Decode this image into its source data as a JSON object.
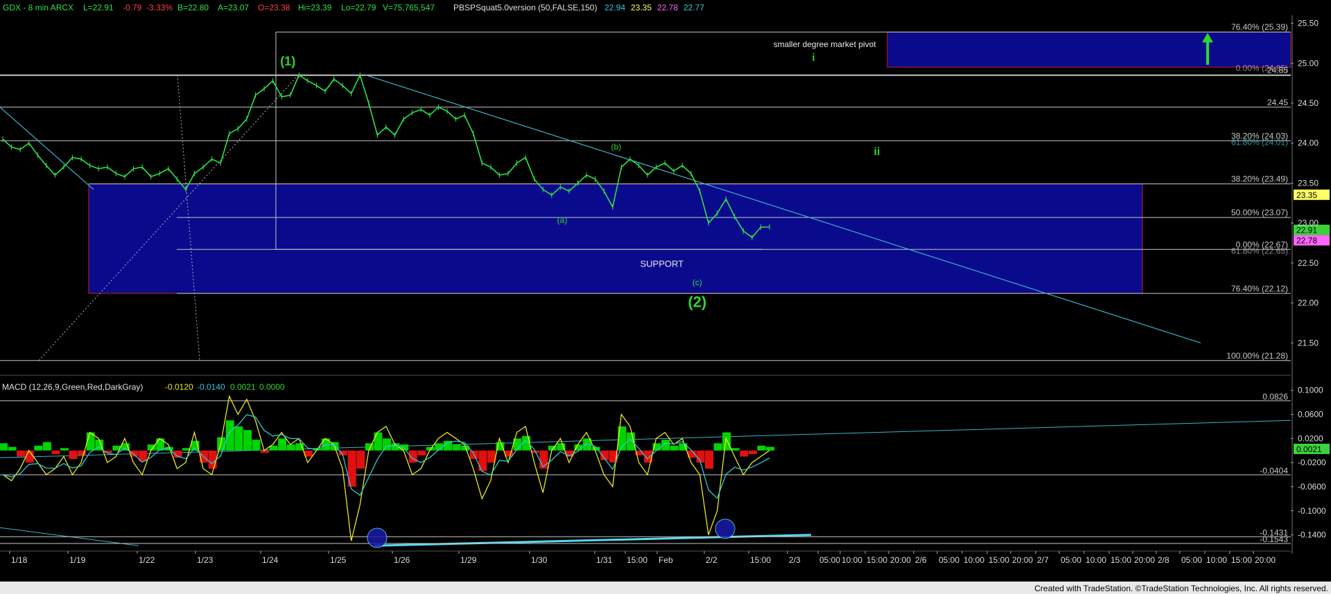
{
  "header": {
    "symbol": "GDX - 8 min ARCX",
    "last": "L=22.91",
    "change": "-0.79",
    "change_pct": "-3.33%",
    "bid": "B=22.80",
    "ask": "A=23.07",
    "open": "O=23.38",
    "high": "Hi=23.39",
    "low": "Lo=22.79",
    "volume": "V=75,765,547",
    "study": "PBSPSquat5.0version (50,FALSE,150)",
    "study_values": [
      "22.94",
      "23.35",
      "22.78",
      "22.77"
    ]
  },
  "colors": {
    "background": "#000000",
    "price": "#2ee24a",
    "accent_green": "#2bd82b",
    "fib_text": "#c8c8c8",
    "fib_line": "#c8c8c8",
    "trendline": "#3cb4c8",
    "box_fill": "#0a0a8c",
    "box_border": "#c0202a",
    "macd_pos": "#00d400",
    "macd_neg": "#e01010",
    "macd_line": "#eaea20",
    "signal_line": "#30c8d8",
    "footer_bg": "#e8e8e8",
    "last_price_tag": "#3cd23c",
    "tag_yellow": "#ffff66",
    "tag_magenta": "#ff66ff"
  },
  "chart_data": [
    {
      "type": "line",
      "name": "price",
      "ylim": [
        21.2,
        25.6
      ],
      "grid": false,
      "yticks": [
        "25.50",
        "25.00",
        "24.50",
        "24.00",
        "23.50",
        "23.00",
        "22.50",
        "22.00",
        "21.50"
      ],
      "ytick_values": [
        25.5,
        25.0,
        24.5,
        24.0,
        23.5,
        23.0,
        22.5,
        22.0,
        21.5
      ],
      "x_session_labels": [
        "1/18",
        "1/19",
        "1/22",
        "1/23",
        "1/24",
        "1/25",
        "1/26",
        "1/29",
        "1/30",
        "1/31",
        "15:00",
        "Feb",
        "2/2",
        "15:00",
        "2/3",
        "05:00",
        "10:00",
        "15:00",
        "20:00",
        "2/6",
        "05:00",
        "10:00",
        "15:00",
        "20:00",
        "2/7",
        "05:00",
        "10:00",
        "15:00",
        "20:00",
        "2/8",
        "05:00",
        "10:00",
        "15:00",
        "20:00"
      ],
      "price_path": [
        24.05,
        23.95,
        23.92,
        24.0,
        23.85,
        23.72,
        23.6,
        23.7,
        23.82,
        23.8,
        23.72,
        23.68,
        23.7,
        23.62,
        23.58,
        23.68,
        23.7,
        23.58,
        23.62,
        23.68,
        23.55,
        23.42,
        23.62,
        23.7,
        23.8,
        23.75,
        24.12,
        24.18,
        24.3,
        24.6,
        24.68,
        24.78,
        24.58,
        24.6,
        24.85,
        24.78,
        24.72,
        24.65,
        24.8,
        24.72,
        24.62,
        24.85,
        24.5,
        24.1,
        24.2,
        24.1,
        24.3,
        24.38,
        24.42,
        24.35,
        24.45,
        24.4,
        24.3,
        24.35,
        24.12,
        23.75,
        23.7,
        23.6,
        23.62,
        23.75,
        23.82,
        23.55,
        23.42,
        23.35,
        23.45,
        23.4,
        23.5,
        23.6,
        23.55,
        23.4,
        23.2,
        23.7,
        23.8,
        23.72,
        23.6,
        23.7,
        23.75,
        23.65,
        23.72,
        23.62,
        23.4,
        23.0,
        23.12,
        23.3,
        23.08,
        22.9,
        22.82,
        22.95,
        22.95
      ],
      "fib_levels": [
        {
          "label": "76.40% (25.39)",
          "value": 25.39
        },
        {
          "label": "24.85",
          "value": 24.85
        },
        {
          "label": "24.45",
          "value": 24.45
        },
        {
          "label": "38.20% (24.03)",
          "value": 24.03
        },
        {
          "label": "38.20% (23.49)",
          "value": 23.49
        },
        {
          "label": "50.00% (23.07)",
          "value": 23.07
        },
        {
          "label": "0.00% (22.67)",
          "value": 22.67
        },
        {
          "label": "76.40% (22.12)",
          "value": 22.12
        },
        {
          "label": "100.00% (21.28)",
          "value": 21.28
        }
      ],
      "fib_overlap_labels": [
        "0.00% (24.85)",
        "61.80% (24.01)",
        "61.80% (22.65)"
      ],
      "annotations": [
        {
          "text": "(1)",
          "x_session": 4.4,
          "y": 24.97
        },
        {
          "text": "(b)",
          "x_session": 9.7,
          "y": 23.92
        },
        {
          "text": "(a)",
          "x_session": 8.5,
          "y": 23.0
        },
        {
          "text": "SUPPORT",
          "x_session": 11.1,
          "y": 22.45
        },
        {
          "text": "(c)",
          "x_session": 11.85,
          "y": 22.22
        },
        {
          "text": "(2)",
          "x_session": 11.85,
          "y": 21.95
        },
        {
          "text": "ii",
          "x_session": 17.5,
          "y": 23.85
        },
        {
          "text": "smaller degree market pivot",
          "x_session": 15.3,
          "y": 25.2
        },
        {
          "text": "i",
          "x_session": 14.85,
          "y": 25.03
        }
      ],
      "price_tags": [
        {
          "text": "23.35",
          "value": 23.35
        },
        {
          "text": "22.91",
          "value": 22.91
        },
        {
          "text": "22.78",
          "value": 22.78
        }
      ]
    },
    {
      "type": "bar",
      "name": "MACD (12,26,9,Green,Red,DarkGray)",
      "legend_values": [
        "-0.0120",
        "-0.0140",
        "0.0021",
        "0.0000"
      ],
      "ylim": [
        -0.16,
        0.11
      ],
      "yticks": [
        "0.1000",
        "0.0600",
        "0.0200",
        "-0.0200",
        "-0.0600",
        "-0.1000",
        "-0.1400"
      ],
      "ytick_values": [
        0.1,
        0.06,
        0.02,
        -0.02,
        -0.06,
        -0.1,
        -0.14
      ],
      "levels": [
        {
          "label": "0.0826",
          "value": 0.0826
        },
        {
          "label": "-0.0404",
          "value": -0.0404
        },
        {
          "label": "-0.1431",
          "value": -0.1431
        },
        {
          "label": "-0.1543",
          "value": -0.1543
        }
      ],
      "current_value": "0.0021",
      "histogram": [
        0.012,
        0.006,
        -0.01,
        -0.02,
        0.008,
        0.014,
        -0.006,
        0.004,
        -0.014,
        -0.008,
        0.03,
        0.018,
        -0.004,
        0.008,
        0.012,
        -0.01,
        -0.018,
        0.01,
        0.02,
        0.006,
        -0.012,
        0.004,
        0.016,
        -0.02,
        -0.03,
        0.022,
        0.05,
        0.04,
        0.034,
        0.018,
        -0.004,
        0.008,
        0.02,
        0.01,
        0.012,
        -0.01,
        0.004,
        0.02,
        0.014,
        -0.008,
        -0.06,
        -0.03,
        0.012,
        0.03,
        0.02,
        0.012,
        0.01,
        -0.02,
        -0.008,
        0.006,
        0.012,
        0.016,
        0.01,
        0.008,
        -0.014,
        -0.034,
        -0.02,
        0.014,
        -0.01,
        0.02,
        0.024,
        -0.004,
        -0.03,
        0.008,
        0.012,
        -0.01,
        0.01,
        0.02,
        0.006,
        -0.016,
        -0.02,
        0.04,
        0.03,
        -0.008,
        -0.02,
        0.012,
        0.018,
        0.008,
        0.012,
        -0.012,
        -0.02,
        -0.03,
        0.012,
        0.03,
        0.004,
        -0.01,
        -0.006,
        0.008,
        0.006
      ],
      "macd": [
        -0.04,
        -0.05,
        -0.03,
        0.0,
        -0.02,
        -0.04,
        -0.03,
        -0.01,
        -0.04,
        -0.02,
        0.03,
        0.02,
        -0.02,
        -0.01,
        0.02,
        -0.02,
        -0.04,
        0.0,
        0.02,
        0.01,
        -0.03,
        -0.02,
        0.03,
        -0.03,
        -0.04,
        0.01,
        0.09,
        0.06,
        0.085,
        0.05,
        0.0,
        0.01,
        0.03,
        0.01,
        0.02,
        -0.02,
        0.0,
        0.02,
        0.01,
        -0.03,
        -0.15,
        -0.09,
        0.0,
        0.03,
        0.04,
        0.01,
        0.0,
        -0.04,
        -0.03,
        0.0,
        0.02,
        0.03,
        0.02,
        0.01,
        -0.03,
        -0.08,
        -0.05,
        0.02,
        -0.02,
        0.03,
        0.04,
        -0.02,
        -0.07,
        0.0,
        0.02,
        -0.02,
        0.01,
        0.03,
        0.0,
        -0.04,
        -0.06,
        0.06,
        0.04,
        -0.02,
        -0.04,
        0.02,
        0.03,
        0.01,
        0.02,
        -0.02,
        -0.04,
        -0.14,
        -0.1,
        0.02,
        -0.01,
        -0.04,
        -0.02,
        -0.01,
        0.0
      ]
    }
  ],
  "footer": {
    "credit": "Created with TradeStation. ©TradeStation Technologies, Inc. All rights reserved."
  }
}
